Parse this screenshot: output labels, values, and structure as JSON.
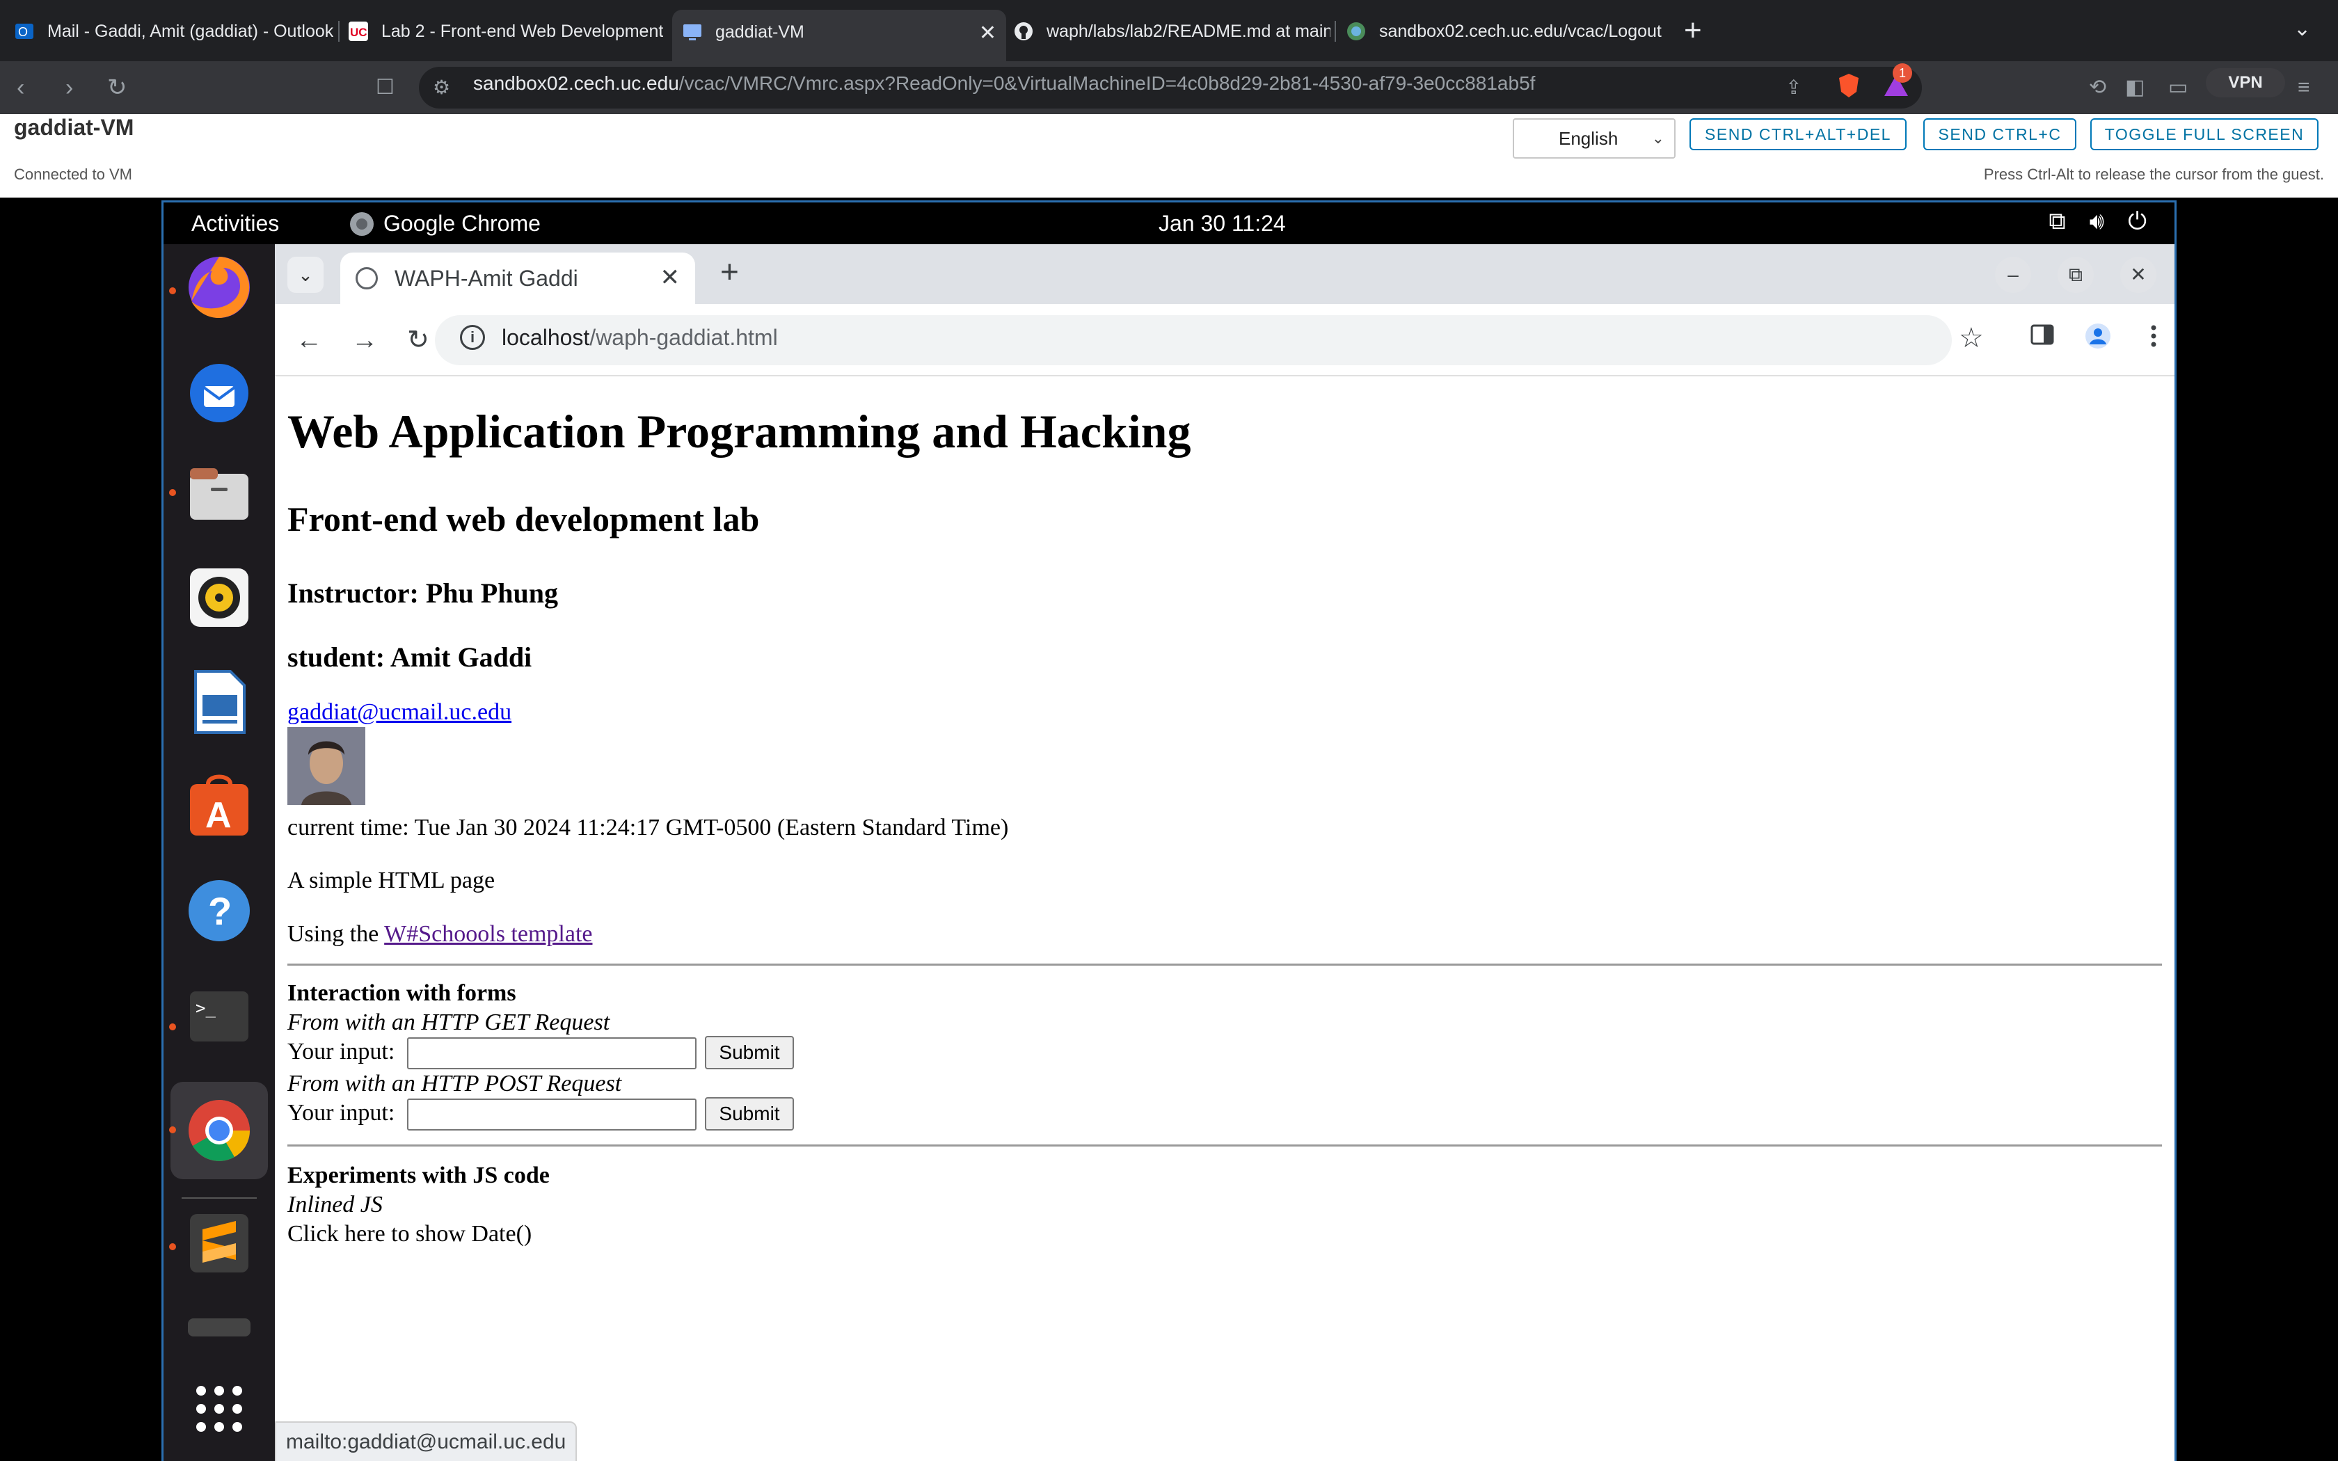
{
  "outer_browser": {
    "tabs": [
      {
        "label": "Mail - Gaddi, Amit (gaddiat) - Outlook",
        "icon": "outlook-icon"
      },
      {
        "label": "Lab 2 - Front-end Web Development",
        "icon": "uc-icon"
      },
      {
        "label": "gaddiat-VM",
        "icon": "monitor-icon",
        "active": true
      },
      {
        "label": "waph/labs/lab2/README.md at main",
        "icon": "github-icon"
      },
      {
        "label": "sandbox02.cech.uc.edu/vcac/Logout",
        "icon": "globe-icon"
      }
    ],
    "url_host": "sandbox02.cech.uc.edu",
    "url_path": "/vcac/VMRC/Vmrc.aspx?ReadOnly=0&VirtualMachineID=4c0b8d29-2b81-4530-af79-3e0cc881ab5f",
    "notification_count": "1",
    "vpn_label": "VPN"
  },
  "vmrc": {
    "title": "gaddiat-VM",
    "status": "Connected to VM",
    "language": "English",
    "buttons": {
      "ctrl_alt_del": "SEND CTRL+ALT+DEL",
      "ctrl_c": "SEND CTRL+C",
      "full_screen": "TOGGLE FULL SCREEN"
    },
    "hint": "Press Ctrl-Alt to release the cursor from the guest."
  },
  "gnome": {
    "activities": "Activities",
    "app_name": "Google Chrome",
    "clock": "Jan 30  11:24"
  },
  "dock": [
    "firefox-icon",
    "thunderbird-icon",
    "files-icon",
    "rhythmbox-icon",
    "writer-icon",
    "app-center-icon",
    "help-icon",
    "terminal-icon",
    "chrome-icon",
    "sublime-icon",
    "drive-icon",
    "show-apps-icon"
  ],
  "chrome": {
    "tab_title": "WAPH-Amit Gaddi",
    "url_host": "localhost",
    "url_path": "/waph-gaddiat.html",
    "status_link": "mailto:gaddiat@ucmail.uc.edu"
  },
  "page": {
    "h1": "Web Application Programming and Hacking",
    "h2": "Front-end web development lab",
    "instructor": "Instructor: Phu Phung",
    "student": "student: Amit Gaddi",
    "email": "gaddiat@ucmail.uc.edu",
    "current_time": "current time: Tue Jan 30 2024 11:24:17 GMT-0500 (Eastern Standard Time)",
    "simple_page": "A simple HTML page",
    "using_prefix": "Using the ",
    "template_link": "W#Schoools template",
    "forms_heading": "Interaction with forms",
    "get_caption": "From with an HTTP GET Request",
    "post_caption": "From with an HTTP POST Request",
    "input_label": "Your input:",
    "submit_label": "Submit",
    "js_heading": "Experiments with JS code",
    "inlined_js": "Inlined JS",
    "click_date": "Click here to show Date()"
  }
}
